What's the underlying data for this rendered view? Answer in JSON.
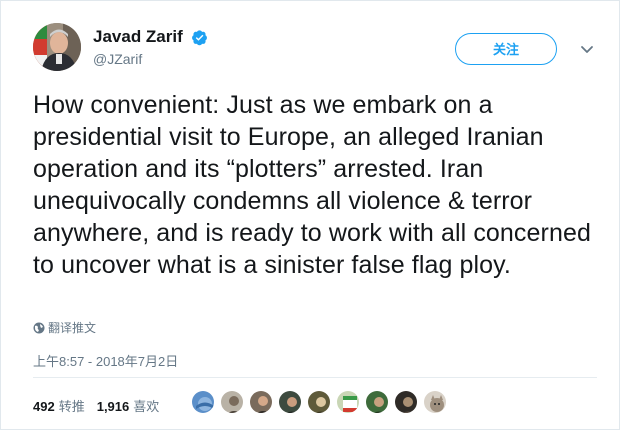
{
  "author": {
    "display_name": "Javad Zarif",
    "handle": "@JZarif"
  },
  "follow_button": {
    "label": "关注"
  },
  "tweet": {
    "text": "How convenient: Just as we embark on a presidential visit to Europe, an alleged Iranian operation and its “plotters” arrested. Iran unequivocally condemns all violence & terror anywhere, and is ready to work with all concerned to uncover what is a sinister false flag ploy.",
    "translate_label": "翻译推文",
    "timestamp": "上午8:57 - 2018年7月2日"
  },
  "stats": {
    "retweets_count": "492",
    "retweets_label": "转推",
    "likes_count": "1,916",
    "likes_label": "喜欢"
  },
  "likers": [
    {
      "icon": "avatar-blue",
      "color": "#5b8fc9"
    },
    {
      "icon": "avatar-man",
      "color": "#b9b2a6"
    },
    {
      "icon": "avatar-man",
      "color": "#7a6b5c"
    },
    {
      "icon": "avatar-man",
      "color": "#3d4a3f"
    },
    {
      "icon": "avatar-man",
      "color": "#5e5a3a"
    },
    {
      "icon": "avatar-flag",
      "color": "#c9d6b5"
    },
    {
      "icon": "avatar-man",
      "color": "#3e6b3b"
    },
    {
      "icon": "avatar-man",
      "color": "#2f2b27"
    },
    {
      "icon": "avatar-cat",
      "color": "#d9d2c8"
    }
  ],
  "colors": {
    "accent": "#1da1f2",
    "text": "#14171a",
    "muted": "#657786"
  }
}
